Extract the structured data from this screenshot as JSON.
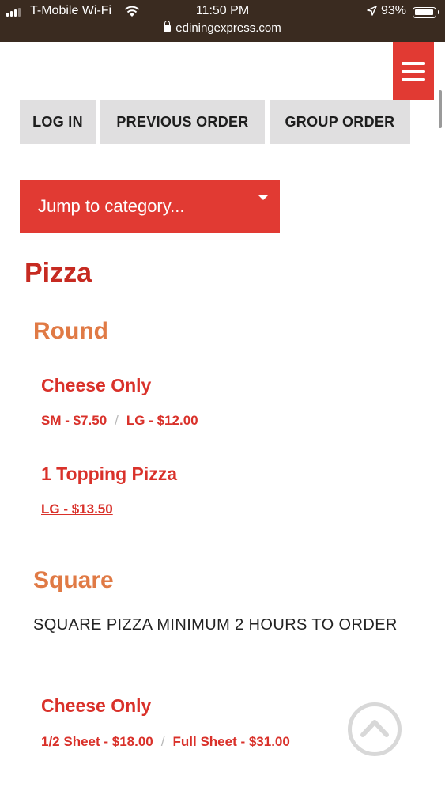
{
  "status_bar": {
    "carrier": "T-Mobile Wi-Fi",
    "time": "11:50 PM",
    "battery_percent": "93%",
    "url": "ediningexpress.com"
  },
  "nav": {
    "menu_icon": "hamburger-icon",
    "login_label": "LOG IN",
    "previous_order_label": "PREVIOUS ORDER",
    "group_order_label": "GROUP ORDER"
  },
  "jump": {
    "label": "Jump to category..."
  },
  "menu": {
    "category": "Pizza",
    "sections": [
      {
        "name": "Round",
        "items": [
          {
            "name": "Cheese Only",
            "prices": [
              "SM - $7.50",
              "LG - $12.00"
            ]
          },
          {
            "name": "1 Topping Pizza",
            "prices": [
              "LG - $13.50"
            ]
          }
        ]
      },
      {
        "name": "Square",
        "note": "SQUARE PIZZA MINIMUM 2 HOURS TO ORDER",
        "items": [
          {
            "name": "Cheese Only",
            "prices": [
              "1/2 Sheet - $18.00",
              "Full Sheet - $31.00"
            ]
          }
        ]
      }
    ],
    "price_separator": "/"
  },
  "colors": {
    "accent": "#e13a33",
    "category_heading": "#c62a21",
    "section_heading": "#e07a45",
    "item_text": "#d9312a",
    "button_bg": "#e0dfe0",
    "status_bar_bg": "#3a2b20"
  }
}
